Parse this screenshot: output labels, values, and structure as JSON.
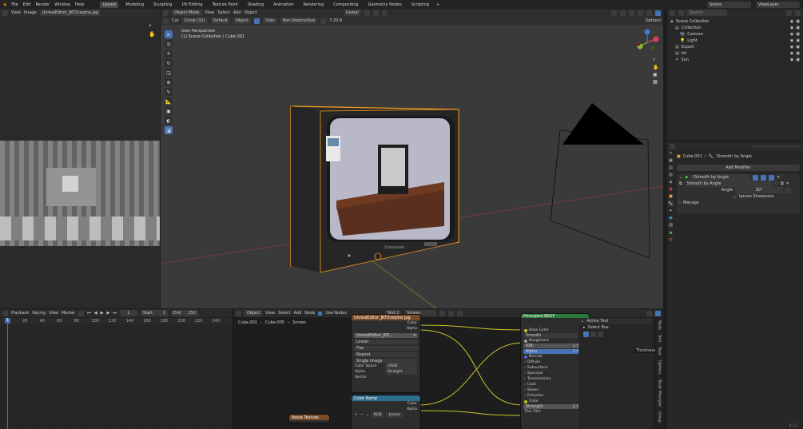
{
  "topbar": {
    "menus": [
      "File",
      "Edit",
      "Render",
      "Window",
      "Help"
    ],
    "workspaces": [
      "Layout",
      "Modeling",
      "Sculpting",
      "UV Editing",
      "Texture Paint",
      "Shading",
      "Animation",
      "Rendering",
      "Compositing",
      "Geometry Nodes",
      "Scripting"
    ],
    "active_workspace": "Layout",
    "plus": "+",
    "scene": "Scene",
    "view_layer": "ViewLayer"
  },
  "image_editor": {
    "menus": [
      "View",
      "Image"
    ],
    "image_name": "UnrealEditor_JKF2ceqme.jpg"
  },
  "viewport": {
    "mode": "Object Mode",
    "menus": [
      "View",
      "Select",
      "Add",
      "Object"
    ],
    "transform": "Global",
    "tool": "Cut",
    "circle": "Circle (32)",
    "default": "Default",
    "object": "Object",
    "dots": "Dots",
    "nondestructive": "Non-Destructive",
    "snap_value": "7.20.8",
    "options": "Options",
    "info_line1": "User Perspective",
    "info_line2": "(1) Scene Collection | Cube.001",
    "tv_brand": "Scanasonic"
  },
  "outliner": {
    "search_placeholder": "Search",
    "rows": [
      {
        "label": "Scene Collection",
        "indent": 0
      },
      {
        "label": "Collection",
        "indent": 1
      },
      {
        "label": "Camera",
        "indent": 2
      },
      {
        "label": "Light",
        "indent": 2
      },
      {
        "label": "Export",
        "indent": 1
      },
      {
        "label": "tst",
        "indent": 1
      },
      {
        "label": "Sun",
        "indent": 1
      }
    ]
  },
  "properties": {
    "object": "Cube.001",
    "modifier_path": "!Smooth by Angle",
    "add_modifier": "Add Modifier",
    "modifier_name": "!Smooth by Angle",
    "sub_modifier": "Smooth by Angle",
    "angle_label": "Angle",
    "angle_value": "30°",
    "ignore_sharpness": "Ignore Sharpness",
    "manage": "Manage"
  },
  "timeline": {
    "menus": [
      "Playback",
      "Keying",
      "View",
      "Marker"
    ],
    "current_frame": "1",
    "start_label": "Start",
    "start_value": "1",
    "end_label": "End",
    "end_value": "250",
    "ticks": [
      "20",
      "40",
      "60",
      "80",
      "100",
      "120",
      "140",
      "160",
      "180",
      "200",
      "220",
      "240"
    ],
    "playhead": "1"
  },
  "node_editor": {
    "type": "Object",
    "menus": [
      "View",
      "Select",
      "Add",
      "Node"
    ],
    "use_nodes": "Use Nodes",
    "slot": "Slot 2",
    "screen": "Screen",
    "breadcrumb": [
      "Cube.001",
      "Cube.005",
      "Screen"
    ],
    "image_node": {
      "title": "UnrealEditor_JKF2ceqme.jpg",
      "out_color": "Color",
      "out_alpha": "Alpha",
      "image_field": "UnrealEditor_JKF...",
      "interp": "Linear",
      "projection": "Flat",
      "extension": "Repeat",
      "source": "Single Image",
      "color_space_label": "Color Space",
      "color_space": "sRGB",
      "alpha_label": "Alpha",
      "alpha": "Straight",
      "vector": "Vector"
    },
    "ramp_node": {
      "title": "Color Ramp",
      "out_color": "Color",
      "out_alpha": "Alpha",
      "mode": "RGB",
      "interp": "Linear"
    },
    "noise_node": {
      "title": "Noise Texture"
    },
    "bsdf_node": {
      "title": "Principled BSDF",
      "base_color": "Base Color",
      "smooth": "Smooth",
      "metallic": "Metallic",
      "roughness": "Roughness",
      "ior_label": "IOR",
      "ior_value": "1.500",
      "alpha_label": "Alpha",
      "alpha_value": "1.000",
      "normal": "Normal",
      "sections": [
        "Diffuse",
        "Subsurface",
        "Specular",
        "Transmission",
        "Coat",
        "Sheen",
        "Emission"
      ],
      "color": "Color",
      "strength_label": "Strength",
      "strength_value": "1.000",
      "thin_film": "Thin Film"
    },
    "active_tool": {
      "title": "Active Tool",
      "select_box": "Select Box"
    },
    "side_tabs": [
      "Node",
      "Tool",
      "View",
      "Options",
      "Node Wrangler",
      "Group"
    ],
    "thickness": "Thickness"
  },
  "status": {
    "version": "4.2.1"
  }
}
